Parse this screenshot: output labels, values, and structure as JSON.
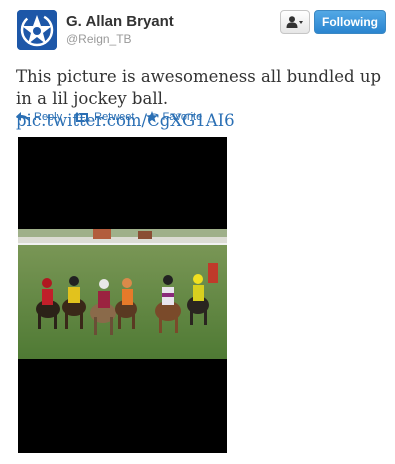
{
  "author": {
    "name": "G. Allan Bryant",
    "handle": "@Reign_TB",
    "avatar_icon": "star-logo-icon",
    "avatar_color": "#1d57a8"
  },
  "header": {
    "user_menu_icon": "person-icon",
    "follow_label": "Following"
  },
  "tweet": {
    "text": "This picture is awesomeness all bundled up in a lil jockey ball.",
    "link": "pic.twitter.com/CgXG1AI6"
  },
  "actions": [
    {
      "label": "Reply",
      "icon": "reply-icon"
    },
    {
      "label": "Retweet",
      "icon": "retweet-icon"
    },
    {
      "label": "Favorite",
      "icon": "star-icon"
    }
  ],
  "colors": {
    "link": "#2a6fb4",
    "follow_button": "#2a85d0",
    "media_background": "#000000"
  },
  "media": {
    "content": "photo of a pony race with young jockeys in colorful silks on green turf"
  }
}
